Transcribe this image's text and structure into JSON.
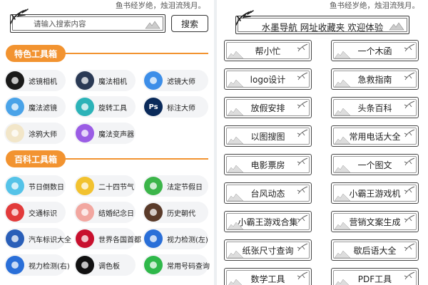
{
  "motto": "鱼书经岁绝，烛泪流残月。",
  "search": {
    "placeholder": "请输入搜索内容",
    "button_label": "搜索"
  },
  "left": {
    "sections": [
      {
        "title": "特色工具箱",
        "items": [
          {
            "label": "滤镜相机",
            "icon": "camera-lens-icon",
            "color": "#1a1a1a"
          },
          {
            "label": "魔法相机",
            "icon": "magic-camera-icon",
            "color": "#2b3a55"
          },
          {
            "label": "滤镜大师",
            "icon": "swirl-icon",
            "color": "#3d8ee8"
          },
          {
            "label": "魔法滤镜",
            "icon": "wave-icon",
            "color": "#4aa3e8"
          },
          {
            "label": "旋转工具",
            "icon": "rotate-ring-icon",
            "color": "#2cb3b8"
          },
          {
            "label": "标注大师",
            "icon": "photoshop-icon",
            "color": "#0a2a5a",
            "glyph": "Ps"
          },
          {
            "label": "涂鸦大师",
            "icon": "palette-icon",
            "color": "#f2e6c9"
          },
          {
            "label": "魔法变声器",
            "icon": "microphone-icon",
            "color": "#9b5de5"
          }
        ]
      },
      {
        "title": "百科工具箱",
        "items": [
          {
            "label": "节日倒数日",
            "icon": "festival-icon",
            "color": "#55c3e8"
          },
          {
            "label": "二十四节气",
            "icon": "solar-terms-icon",
            "color": "#f2c230"
          },
          {
            "label": "法定节假日",
            "icon": "holiday-icon",
            "color": "#3cb54a"
          },
          {
            "label": "交通标识",
            "icon": "no-entry-icon",
            "color": "#e23b3b"
          },
          {
            "label": "结婚纪念日",
            "icon": "wedding-icon",
            "color": "#f2a7a0"
          },
          {
            "label": "历史朝代",
            "icon": "history-icon",
            "color": "#5a3b2a"
          },
          {
            "label": "汽车标识大全",
            "icon": "car-logo-icon",
            "color": "#2a5fb8"
          },
          {
            "label": "世界各国首都",
            "icon": "world-icon",
            "color": "#c8102e"
          },
          {
            "label": "视力检测(左)",
            "icon": "eye-left-icon",
            "color": "#2a6fd8"
          },
          {
            "label": "视力检测(右)",
            "icon": "eye-right-icon",
            "color": "#2a6fd8"
          },
          {
            "label": "调色板",
            "icon": "color-palette-icon",
            "color": "#111111"
          },
          {
            "label": "常用号码查询",
            "icon": "phone-icon",
            "color": "#2fb84a"
          }
        ]
      }
    ]
  },
  "right": {
    "title": "水墨导航 网址收藏夹 欢迎体验",
    "items": [
      "帮小忙",
      "一个木函",
      "logo设计",
      "急救指南",
      "放假安排",
      "头条百科",
      "以图搜图",
      "常用电话大全",
      "电影票房",
      "一个图文",
      "台风动态",
      "小霸王游戏机",
      "小霸王游戏合集",
      "营销文案生成",
      "纸张尺寸查询",
      "歇后语大全",
      "数学工具",
      "PDF工具"
    ]
  }
}
